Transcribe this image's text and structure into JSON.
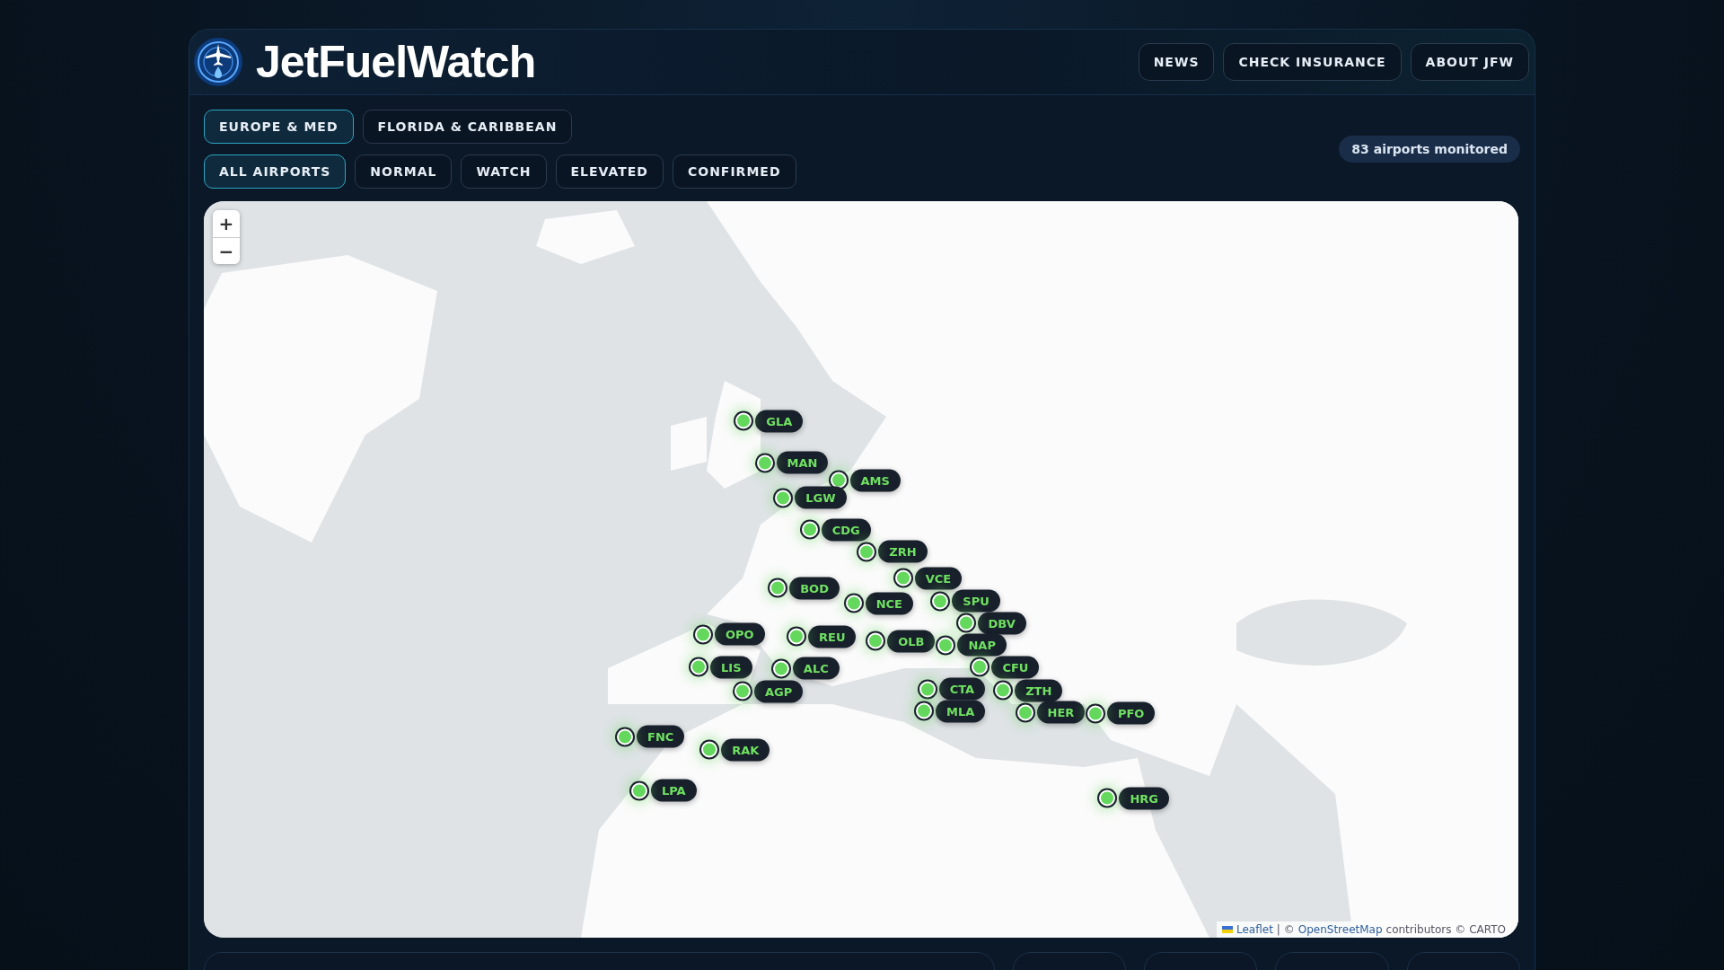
{
  "header": {
    "title": "JetFuelWatch",
    "nav": [
      "NEWS",
      "CHECK INSURANCE",
      "ABOUT JFW"
    ]
  },
  "region_tabs": [
    {
      "label": "EUROPE & MED",
      "selected": true
    },
    {
      "label": "FLORIDA & CARIBBEAN",
      "selected": false
    }
  ],
  "status_filters": [
    {
      "label": "ALL AIRPORTS",
      "selected": true
    },
    {
      "label": "NORMAL",
      "selected": false
    },
    {
      "label": "WATCH",
      "selected": false
    },
    {
      "label": "ELEVATED",
      "selected": false
    },
    {
      "label": "CONFIRMED",
      "selected": false
    }
  ],
  "count_badge": "83 airports monitored",
  "map": {
    "zoom_in": "+",
    "zoom_out": "−",
    "attribution": {
      "leaflet": "Leaflet",
      "separator": "| ©",
      "osm": "OpenStreetMap",
      "rest": "contributors © CARTO"
    },
    "markers": [
      {
        "code": "GLA"
      },
      {
        "code": "MAN"
      },
      {
        "code": "AMS"
      },
      {
        "code": "LGW"
      },
      {
        "code": "CDG"
      },
      {
        "code": "ZRH"
      },
      {
        "code": "VCE"
      },
      {
        "code": "BOD"
      },
      {
        "code": "NCE"
      },
      {
        "code": "SPU"
      },
      {
        "code": "DBV"
      },
      {
        "code": "OPO"
      },
      {
        "code": "REU"
      },
      {
        "code": "OLB"
      },
      {
        "code": "NAP"
      },
      {
        "code": "LIS"
      },
      {
        "code": "ALC"
      },
      {
        "code": "CFU"
      },
      {
        "code": "AGP"
      },
      {
        "code": "CTA"
      },
      {
        "code": "ZTH"
      },
      {
        "code": "MLA"
      },
      {
        "code": "HER"
      },
      {
        "code": "PFO"
      },
      {
        "code": "FNC"
      },
      {
        "code": "RAK"
      },
      {
        "code": "LPA"
      },
      {
        "code": "HRG"
      }
    ]
  }
}
